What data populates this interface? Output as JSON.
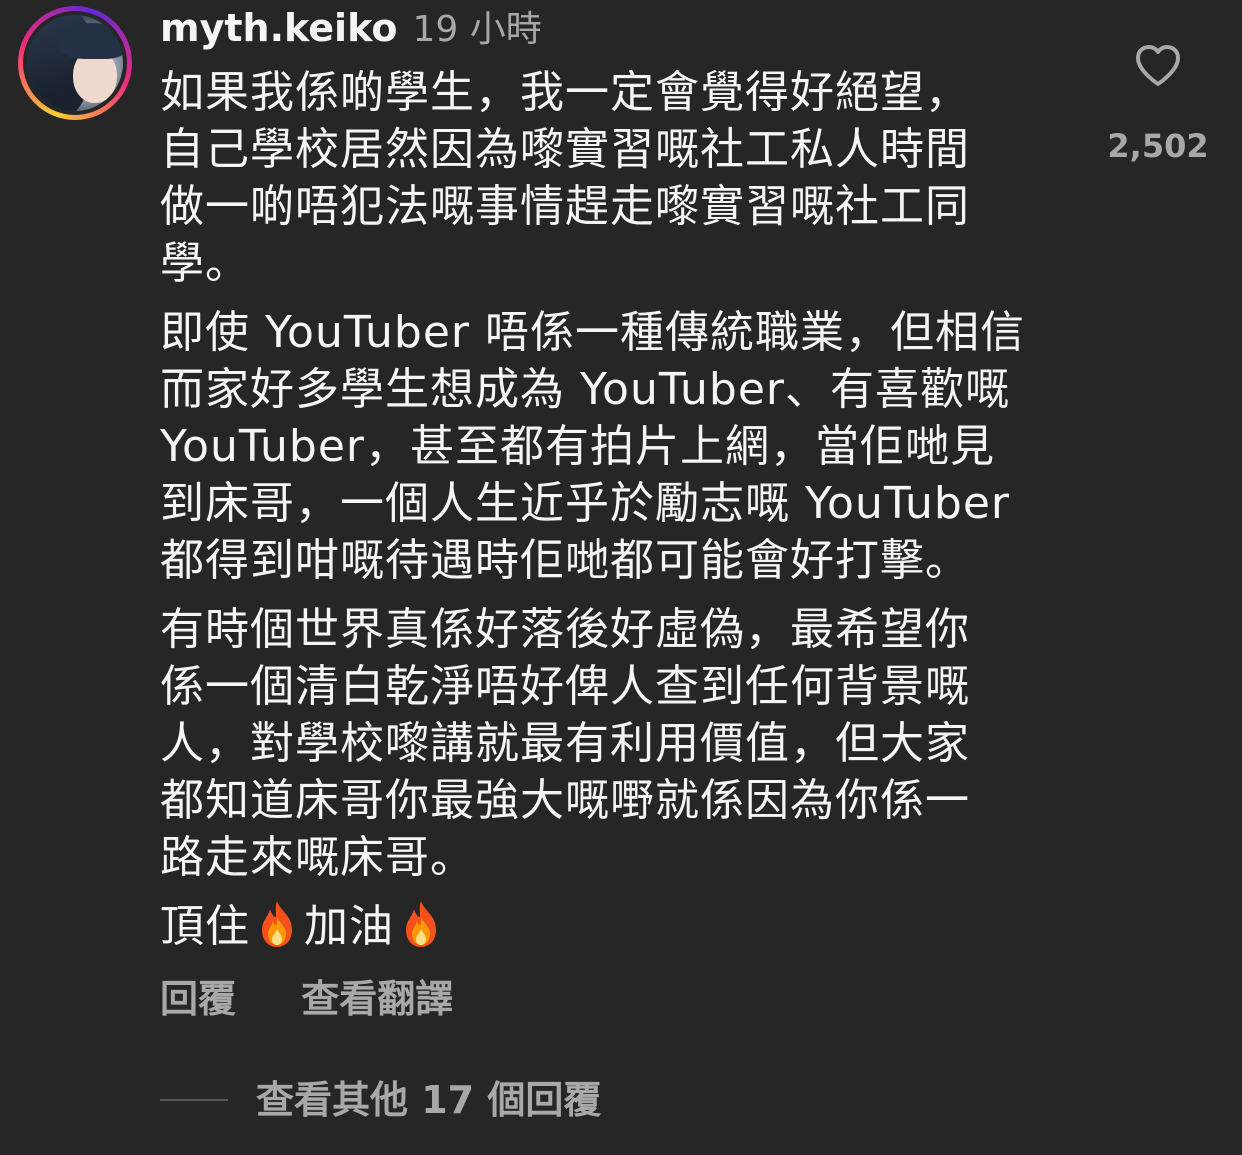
{
  "comment": {
    "username": "myth.keiko",
    "time": "19 小時",
    "paragraphs": [
      [
        "如果我係啲學生，我一定會覺得好絕望，",
        "自己學校居然因為嚟實習嘅社工私人時間",
        "做一啲唔犯法嘅事情趕走嚟實習嘅社工同",
        "學。"
      ],
      [
        "即使 YouTuber 唔係一種傳統職業，但相信",
        "而家好多學生想成為 YouTuber、有喜歡嘅",
        "YouTuber，甚至都有拍片上網，當佢哋見",
        "到床哥，一個人生近乎於勵志嘅 YouTuber",
        "都得到咁嘅待遇時佢哋都可能會好打擊。"
      ],
      [
        "有時個世界真係好落後好虛偽，最希望你",
        "係一個清白乾淨唔好俾人查到任何背景嘅",
        "人，對學校嚟講就最有利用價值，但大家",
        "都知道床哥你最強大嘅嘢就係因為你係一",
        "路走來嘅床哥。"
      ]
    ],
    "last_line": {
      "part1": "頂住",
      "part2": "加油",
      "emoji": "fire-icon"
    },
    "like_count": "2,502",
    "reply_label": "回覆",
    "translate_label": "查看翻譯",
    "view_replies_label": "查看其他 17 個回覆"
  },
  "colors": {
    "background": "#262626",
    "text": "#f5f5f5",
    "secondary": "#a8a8a8"
  }
}
